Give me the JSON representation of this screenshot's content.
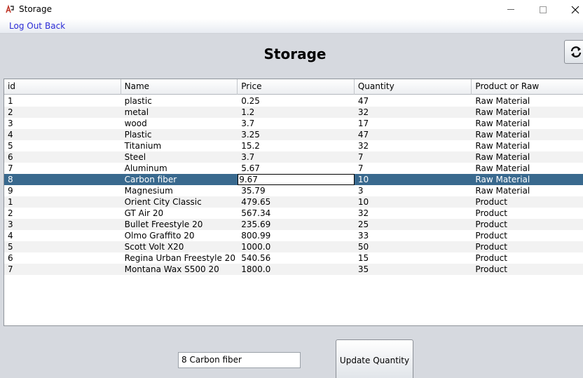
{
  "window": {
    "title": "Storage"
  },
  "menu": {
    "logout": "Log Out",
    "back": "Back"
  },
  "page": {
    "title": "Storage"
  },
  "table": {
    "columns": [
      "id",
      "Name",
      "Price",
      "Quantity",
      "Product or Raw"
    ],
    "selected_row": 7,
    "rows": [
      [
        "1",
        "plastic",
        "0.25",
        "47",
        "Raw Material"
      ],
      [
        "2",
        "metal",
        "1.2",
        "32",
        "Raw Material"
      ],
      [
        "3",
        "wood",
        "3.7",
        "17",
        "Raw Material"
      ],
      [
        "4",
        "Plastic",
        "3.25",
        "47",
        "Raw Material"
      ],
      [
        "5",
        "Titanium",
        "15.2",
        "32",
        "Raw Material"
      ],
      [
        "6",
        "Steel",
        "3.7",
        "7",
        "Raw Material"
      ],
      [
        "7",
        "Aluminum",
        "5.67",
        "7",
        "Raw Material"
      ],
      [
        "8",
        "Carbon fiber",
        "9.67",
        "10",
        "Raw Material"
      ],
      [
        "9",
        "Magnesium",
        "35.79",
        "3",
        "Raw Material"
      ],
      [
        "1",
        "Orient City Classic",
        "479.65",
        "10",
        "Product"
      ],
      [
        "2",
        "GT Air 20",
        "567.34",
        "32",
        "Product"
      ],
      [
        "3",
        "Bullet Freestyle 20",
        "235.69",
        "25",
        "Product"
      ],
      [
        "4",
        "Olmo Graffito 20",
        "800.99",
        "33",
        "Product"
      ],
      [
        "5",
        "Scott Volt X20",
        "1000.0",
        "50",
        "Product"
      ],
      [
        "6",
        "Regina Urban Freestyle 20",
        "540.56",
        "15",
        "Product"
      ],
      [
        "7",
        "Montana Wax S500 20",
        "1800.0",
        "35",
        "Product"
      ]
    ]
  },
  "selected_item": {
    "value": "8 Carbon fiber"
  },
  "buttons": {
    "update_quantity": "Update Quantity"
  },
  "icons": {
    "app": "app-logo-icon",
    "refresh": "refresh-icon"
  },
  "colors": {
    "selection": "#39698e",
    "link": "#2b2bd6",
    "panel": "#d6d9df"
  }
}
